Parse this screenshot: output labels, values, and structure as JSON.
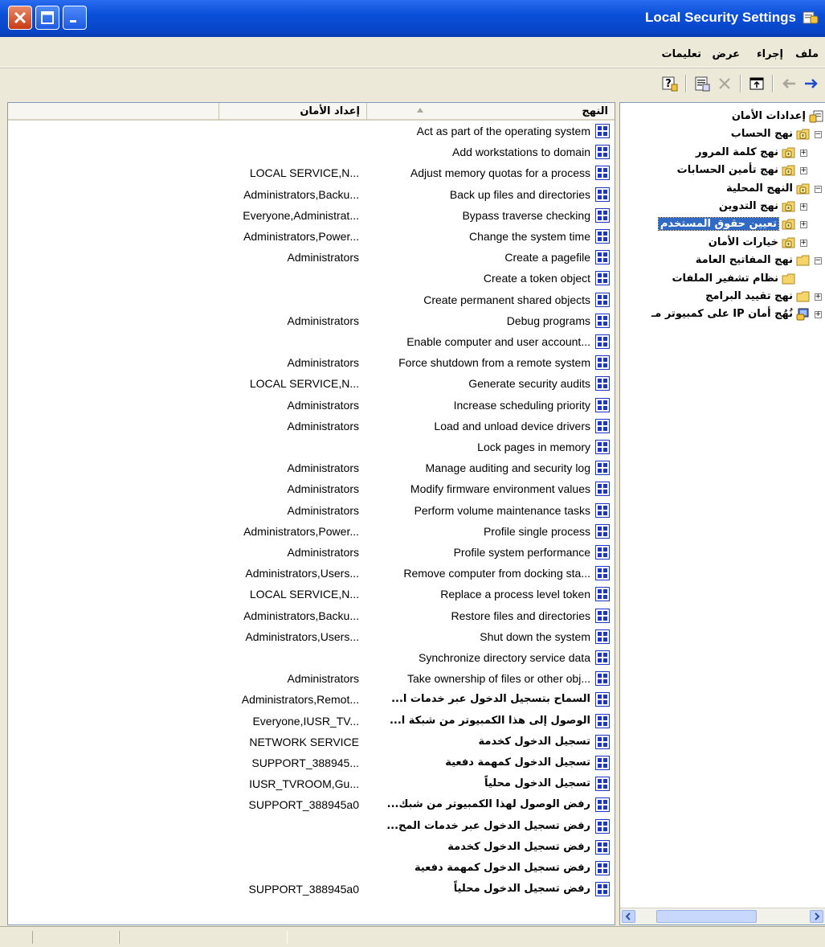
{
  "window": {
    "title": "Local Security Settings"
  },
  "menu": [
    "ملف",
    "إجراء",
    "عرض",
    "تعليمات"
  ],
  "list": {
    "headers": {
      "policy": "النهج",
      "setting": "إعداد الأمان"
    },
    "rows": [
      {
        "policy": "Act as part of the operating system",
        "setting": ""
      },
      {
        "policy": "Add workstations to domain",
        "setting": ""
      },
      {
        "policy": "Adjust memory quotas for a process",
        "setting": "LOCAL SERVICE,N..."
      },
      {
        "policy": "Back up files and directories",
        "setting": "Administrators,Backu..."
      },
      {
        "policy": "Bypass traverse checking",
        "setting": "Everyone,Administrat..."
      },
      {
        "policy": "Change the system time",
        "setting": "Administrators,Power..."
      },
      {
        "policy": "Create a pagefile",
        "setting": "Administrators"
      },
      {
        "policy": "Create a token object",
        "setting": ""
      },
      {
        "policy": "Create permanent shared objects",
        "setting": ""
      },
      {
        "policy": "Debug programs",
        "setting": "Administrators"
      },
      {
        "policy": "Enable computer and user account...",
        "setting": ""
      },
      {
        "policy": "Force shutdown from a remote system",
        "setting": "Administrators"
      },
      {
        "policy": "Generate security audits",
        "setting": "LOCAL SERVICE,N..."
      },
      {
        "policy": "Increase scheduling priority",
        "setting": "Administrators"
      },
      {
        "policy": "Load and unload device drivers",
        "setting": "Administrators"
      },
      {
        "policy": "Lock pages in memory",
        "setting": ""
      },
      {
        "policy": "Manage auditing and security log",
        "setting": "Administrators"
      },
      {
        "policy": "Modify firmware environment values",
        "setting": "Administrators"
      },
      {
        "policy": "Perform volume maintenance tasks",
        "setting": "Administrators"
      },
      {
        "policy": "Profile single process",
        "setting": "Administrators,Power..."
      },
      {
        "policy": "Profile system performance",
        "setting": "Administrators"
      },
      {
        "policy": "Remove computer from docking sta...",
        "setting": "Administrators,Users..."
      },
      {
        "policy": "Replace a process level token",
        "setting": "LOCAL SERVICE,N..."
      },
      {
        "policy": "Restore files and directories",
        "setting": "Administrators,Backu..."
      },
      {
        "policy": "Shut down the system",
        "setting": "Administrators,Users..."
      },
      {
        "policy": "Synchronize directory service data",
        "setting": ""
      },
      {
        "policy": "Take ownership of files or other obj...",
        "setting": "Administrators"
      },
      {
        "policy": "السماح بتسجيل الدخول عبر خدمات ا...",
        "setting": "Administrators,Remot...",
        "arabic": true
      },
      {
        "policy": "الوصول إلى هذا الكمبيوتر من شبكة ا...",
        "setting": "Everyone,IUSR_TV...",
        "arabic": true
      },
      {
        "policy": "تسجيل الدخول كخدمة",
        "setting": "NETWORK SERVICE",
        "arabic": true
      },
      {
        "policy": "تسجيل الدخول كمهمة دفعية",
        "setting": "SUPPORT_388945...",
        "arabic": true
      },
      {
        "policy": "تسجيل الدخول محلياً",
        "setting": "IUSR_TVROOM,Gu...",
        "arabic": true
      },
      {
        "policy": "رفض الوصول لهذا الكمبيوتر من شبك...",
        "setting": "SUPPORT_388945a0",
        "arabic": true
      },
      {
        "policy": "رفض تسجيل الدخول عبر خدمات المح...",
        "setting": "",
        "arabic": true
      },
      {
        "policy": "رفض تسجيل الدخول كخدمة",
        "setting": "",
        "arabic": true
      },
      {
        "policy": "رفض تسجيل الدخول كمهمة دفعية",
        "setting": "",
        "arabic": true
      },
      {
        "policy": "رفض تسجيل الدخول محلياً",
        "setting": "SUPPORT_388945a0",
        "arabic": true
      }
    ]
  },
  "tree": [
    {
      "label": "إعدادات الأمان",
      "level": 0,
      "expander": "",
      "icon": "security-settings-icon"
    },
    {
      "label": "نهج الحساب",
      "level": 1,
      "expander": "−",
      "icon": "policy-folder-icon"
    },
    {
      "label": "نهج كلمة المرور",
      "level": 2,
      "expander": "+",
      "icon": "policy-folder-icon"
    },
    {
      "label": "نهج تأمين الحسابات",
      "level": 2,
      "expander": "+",
      "icon": "policy-folder-icon"
    },
    {
      "label": "النهج المحلية",
      "level": 1,
      "expander": "−",
      "icon": "policy-folder-icon"
    },
    {
      "label": "نهج التدوين",
      "level": 2,
      "expander": "+",
      "icon": "policy-folder-icon"
    },
    {
      "label": "تعيين حقوق المستخدم",
      "level": 2,
      "expander": "+",
      "icon": "policy-folder-icon",
      "selected": true
    },
    {
      "label": "خيارات الأمان",
      "level": 2,
      "expander": "+",
      "icon": "policy-folder-icon"
    },
    {
      "label": "نهج المفاتيح العامة",
      "level": 1,
      "expander": "−",
      "icon": "folder-icon"
    },
    {
      "label": "نظام تشفير الملفات",
      "level": 2,
      "expander": "",
      "icon": "folder-icon"
    },
    {
      "label": "نهج تقييد البرامج",
      "level": 1,
      "expander": "+",
      "icon": "folder-icon"
    },
    {
      "label": "نُهُج أمان IP على كمبيوتر مـ",
      "level": 1,
      "expander": "+",
      "icon": "ip-security-icon"
    }
  ],
  "colors": {
    "titlebar": "#0a4fd8",
    "selection": "#316ac5",
    "policy_icon": "#1c36c8",
    "folder": "#f5d46a"
  }
}
